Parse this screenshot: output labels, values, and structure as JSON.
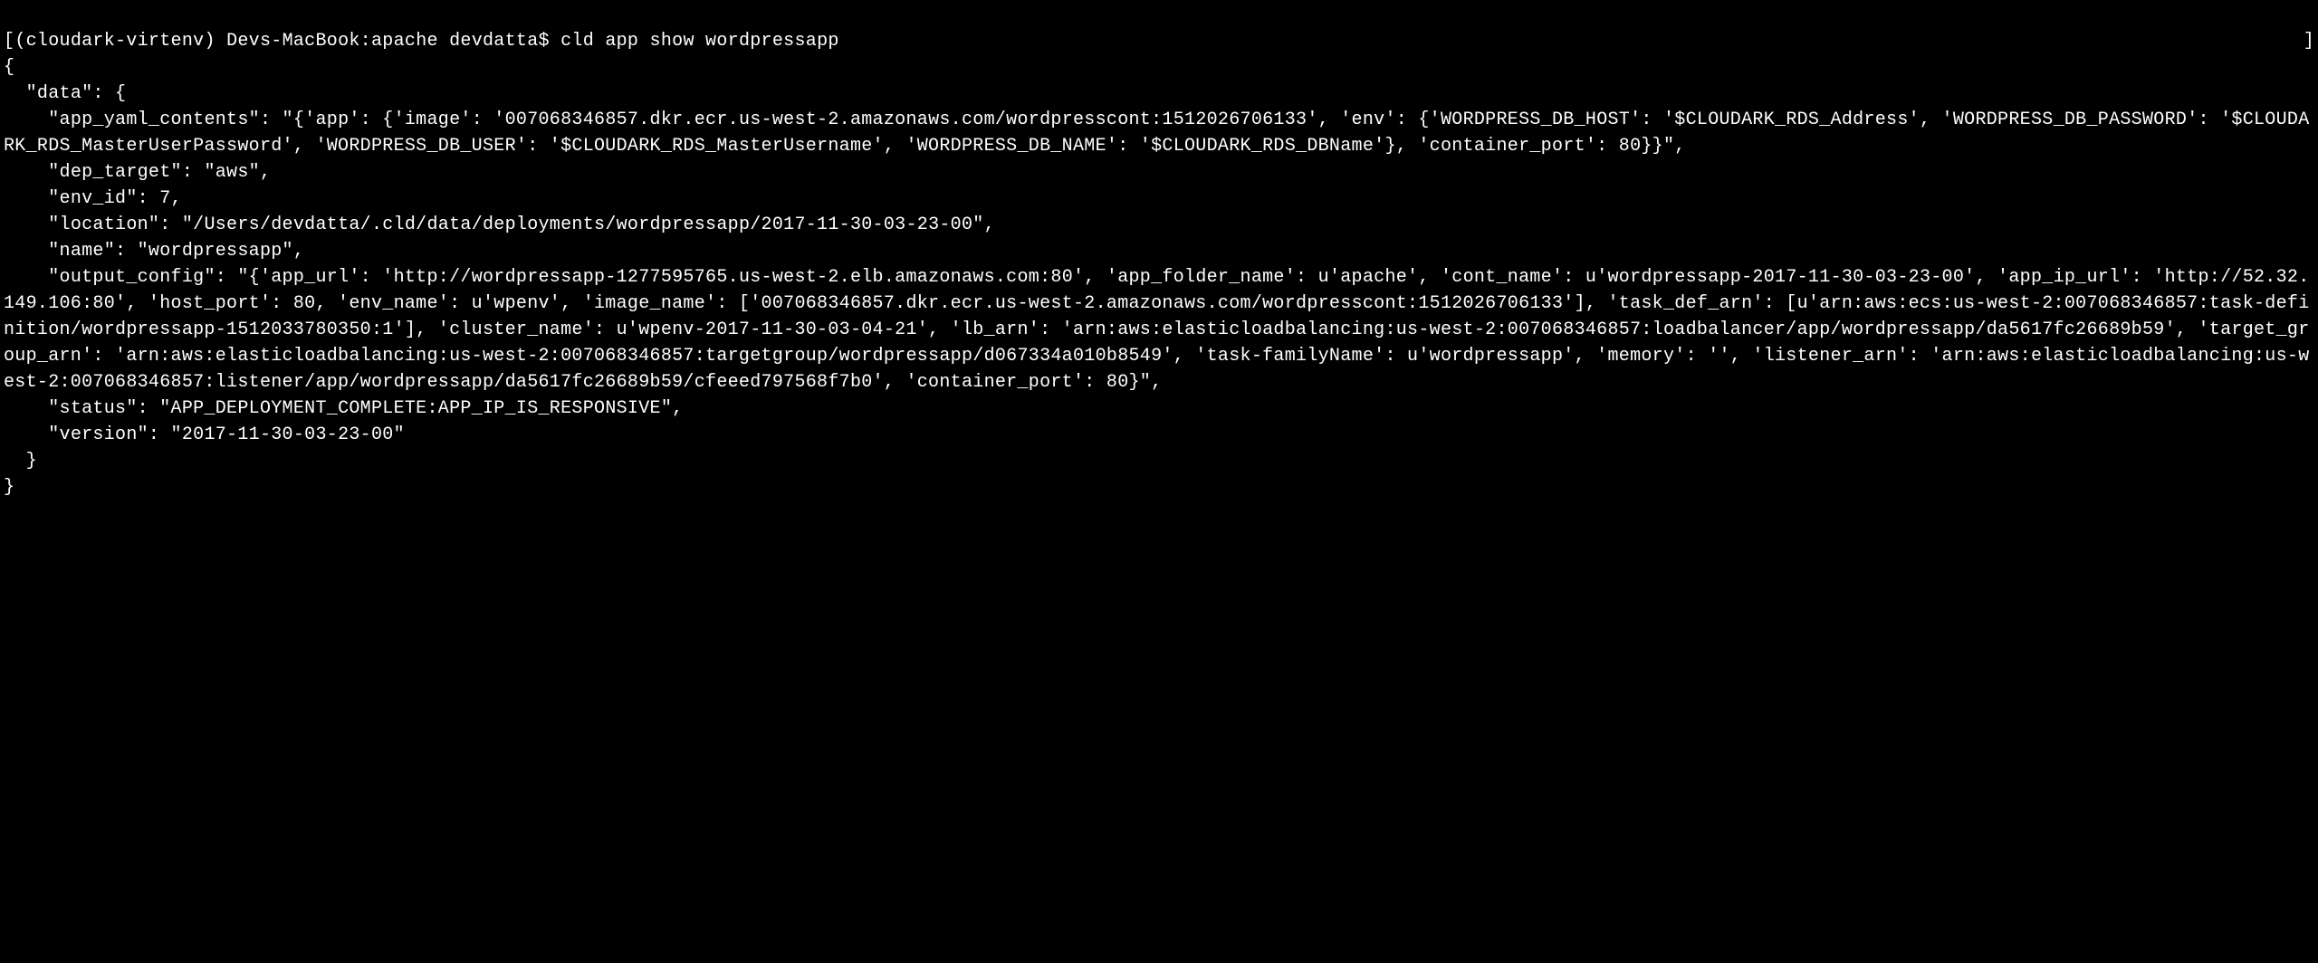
{
  "terminal": {
    "prompt_bracket": "[",
    "prompt_env": "(cloudark-virtenv) ",
    "prompt_host": "Devs-MacBook:apache devdatta$ ",
    "command": "cld app show wordpressapp",
    "prompt_close": "]",
    "output_lines": [
      "{",
      "  \"data\": {",
      "    \"app_yaml_contents\": \"{'app': {'image': '007068346857.dkr.ecr.us-west-2.amazonaws.com/wordpresscont:1512026706133', 'env': {'WORDPRESS_DB_HOST': '$CLOUDARK_RDS_Address', 'WORDPRESS_DB_PASSWORD': '$CLOUDARK_RDS_MasterUserPassword', 'WORDPRESS_DB_USER': '$CLOUDARK_RDS_MasterUsername', 'WORDPRESS_DB_NAME': '$CLOUDARK_RDS_DBName'}, 'container_port': 80}}\",",
      "    \"dep_target\": \"aws\",",
      "    \"env_id\": 7,",
      "    \"location\": \"/Users/devdatta/.cld/data/deployments/wordpressapp/2017-11-30-03-23-00\",",
      "    \"name\": \"wordpressapp\",",
      "    \"output_config\": \"{'app_url': 'http://wordpressapp-1277595765.us-west-2.elb.amazonaws.com:80', 'app_folder_name': u'apache', 'cont_name': u'wordpressapp-2017-11-30-03-23-00', 'app_ip_url': 'http://52.32.149.106:80', 'host_port': 80, 'env_name': u'wpenv', 'image_name': ['007068346857.dkr.ecr.us-west-2.amazonaws.com/wordpresscont:1512026706133'], 'task_def_arn': [u'arn:aws:ecs:us-west-2:007068346857:task-definition/wordpressapp-1512033780350:1'], 'cluster_name': u'wpenv-2017-11-30-03-04-21', 'lb_arn': 'arn:aws:elasticloadbalancing:us-west-2:007068346857:loadbalancer/app/wordpressapp/da5617fc26689b59', 'target_group_arn': 'arn:aws:elasticloadbalancing:us-west-2:007068346857:targetgroup/wordpressapp/d067334a010b8549', 'task-familyName': u'wordpressapp', 'memory': '', 'listener_arn': 'arn:aws:elasticloadbalancing:us-west-2:007068346857:listener/app/wordpressapp/da5617fc26689b59/cfeeed797568f7b0', 'container_port': 80}\",",
      "    \"status\": \"APP_DEPLOYMENT_COMPLETE:APP_IP_IS_RESPONSIVE\",",
      "    \"version\": \"2017-11-30-03-23-00\"",
      "  }",
      "}"
    ]
  }
}
